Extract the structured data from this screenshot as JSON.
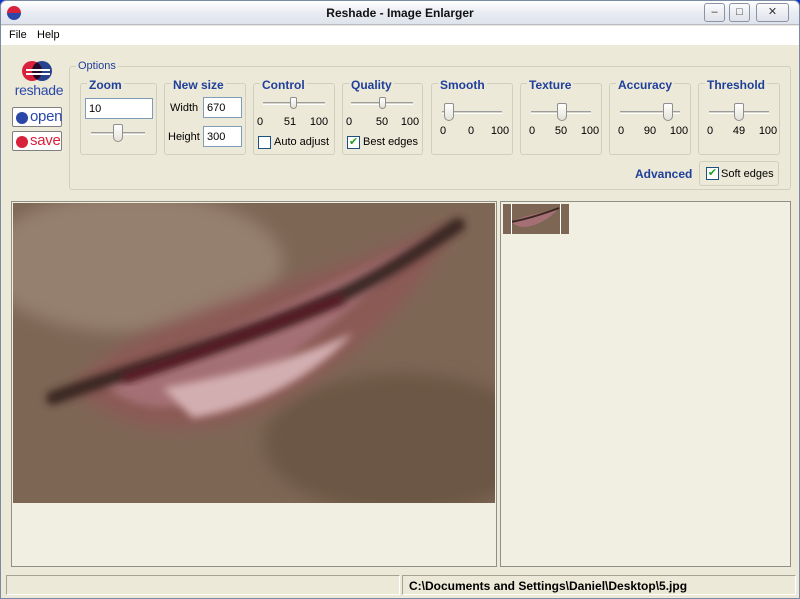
{
  "window": {
    "title": "Reshade - Image Enlarger",
    "minimize": "–",
    "maximize": "□",
    "close": "✕"
  },
  "menu": {
    "file": "File",
    "help": "Help"
  },
  "sidebar": {
    "logo_text": "reshade",
    "open_label": "open",
    "save_label": "save"
  },
  "options": {
    "legend": "Options",
    "zoom": {
      "title": "Zoom",
      "value": "10",
      "slider_value": 10
    },
    "new_size": {
      "title": "New size",
      "width_label": "Width",
      "width_value": "670",
      "height_label": "Height",
      "height_value": "300"
    },
    "control": {
      "title": "Control",
      "min": "0",
      "value": "51",
      "max": "100",
      "auto_adjust_label": "Auto adjust",
      "auto_adjust_checked": false
    },
    "quality": {
      "title": "Quality",
      "min": "0",
      "value": "50",
      "max": "100",
      "best_edges_label": "Best edges",
      "best_edges_checked": true
    },
    "smooth": {
      "title": "Smooth",
      "min": "0",
      "value": "0",
      "max": "100"
    },
    "texture": {
      "title": "Texture",
      "min": "0",
      "value": "50",
      "max": "100"
    },
    "accuracy": {
      "title": "Accuracy",
      "min": "0",
      "value": "90",
      "max": "100"
    },
    "threshold": {
      "title": "Threshold",
      "min": "0",
      "value": "49",
      "max": "100"
    },
    "advanced_label": "Advanced",
    "soft_edges_label": "Soft edges",
    "soft_edges_checked": true
  },
  "status": {
    "path": "C:\\Documents and Settings\\Daniel\\Desktop\\5.jpg"
  },
  "colors": {
    "accent_blue": "#1f3f9a",
    "brand_red": "#d8213b",
    "brand_blue": "#2b47a8",
    "check_green": "#21a121"
  }
}
